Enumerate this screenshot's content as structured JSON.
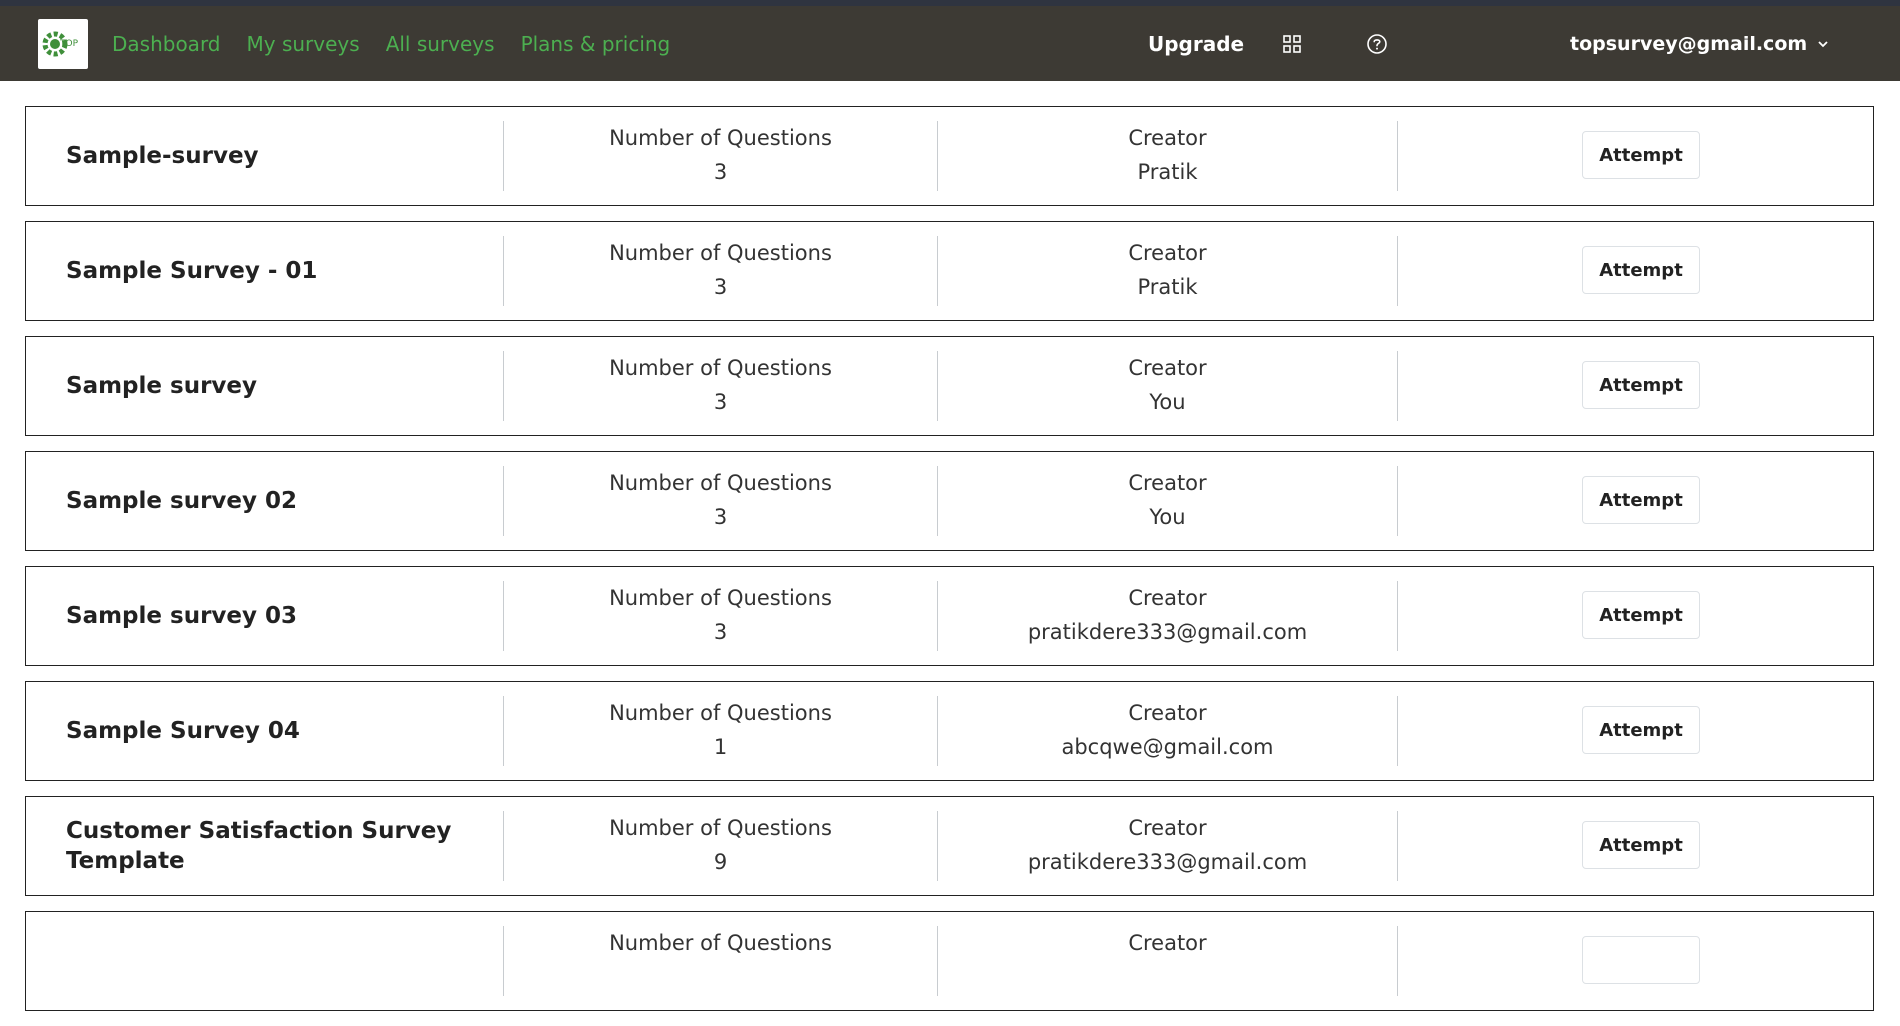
{
  "nav": {
    "links": [
      "Dashboard",
      "My surveys",
      "All surveys",
      "Plans & pricing"
    ],
    "upgrade": "Upgrade",
    "account_email": "topsurvey@gmail.com",
    "logo_text": "TOP",
    "accent_color": "#4caf50",
    "bar_color": "#3d3a34"
  },
  "surveys": [
    {
      "title": "Sample-survey",
      "questions_label": "Number of Questions",
      "questions": "3",
      "creator_label": "Creator",
      "creator": "Pratik",
      "action": "Attempt"
    },
    {
      "title": "Sample Survey - 01",
      "questions_label": "Number of Questions",
      "questions": "3",
      "creator_label": "Creator",
      "creator": "Pratik",
      "action": "Attempt"
    },
    {
      "title": "Sample survey",
      "questions_label": "Number of Questions",
      "questions": "3",
      "creator_label": "Creator",
      "creator": "You",
      "action": "Attempt"
    },
    {
      "title": "Sample survey 02",
      "questions_label": "Number of Questions",
      "questions": "3",
      "creator_label": "Creator",
      "creator": "You",
      "action": "Attempt"
    },
    {
      "title": "Sample survey 03",
      "questions_label": "Number of Questions",
      "questions": "3",
      "creator_label": "Creator",
      "creator": "pratikdere333@gmail.com",
      "action": "Attempt"
    },
    {
      "title": "Sample Survey 04",
      "questions_label": "Number of Questions",
      "questions": "1",
      "creator_label": "Creator",
      "creator": "abcqwe@gmail.com",
      "action": "Attempt"
    },
    {
      "title": "Customer Satisfaction Survey Template",
      "questions_label": "Number of Questions",
      "questions": "9",
      "creator_label": "Creator",
      "creator": "pratikdere333@gmail.com",
      "action": "Attempt"
    },
    {
      "title": "",
      "questions_label": "Number of Questions",
      "questions": "",
      "creator_label": "Creator",
      "creator": "",
      "action": ""
    }
  ]
}
